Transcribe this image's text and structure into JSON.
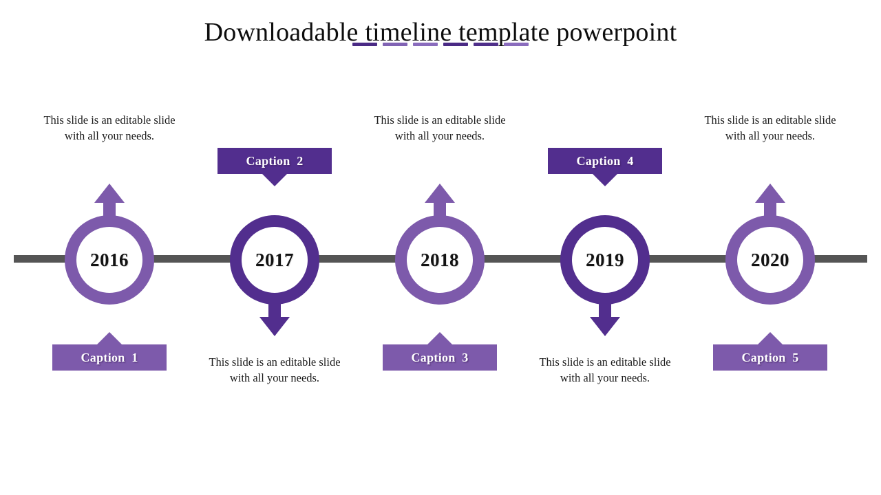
{
  "slide": {
    "title": "Downloadable timeline template powerpoint",
    "background_color": "#ffffff",
    "axis_color": "#555555"
  },
  "theme": {
    "purple_dark": "#522e8e",
    "purple_light": "#7d5aab",
    "text_color": "#1b1b1b",
    "caption_text_color": "#ffffff"
  },
  "title_dashes": [
    {
      "color": "#4a2a85"
    },
    {
      "color": "#8163b4"
    },
    {
      "color": "#8a6cbd"
    },
    {
      "color": "#4a2a85"
    },
    {
      "color": "#4f2f8a"
    },
    {
      "color": "#8a6cbd"
    }
  ],
  "body_text": "This slide is an editable slide with all your needs.",
  "nodes": [
    {
      "year": "2016",
      "caption": "Caption  1",
      "description": "This slide is an editable slide with all your needs.",
      "color": "#7d5aab",
      "arrow_direction": "up",
      "caption_position": "bottom",
      "description_position": "top"
    },
    {
      "year": "2017",
      "caption": "Caption  2",
      "description": "This slide is an editable slide with all your needs.",
      "color": "#522e8e",
      "arrow_direction": "down",
      "caption_position": "top",
      "description_position": "bottom"
    },
    {
      "year": "2018",
      "caption": "Caption  3",
      "description": "This slide is an editable slide with all your needs.",
      "color": "#7d5aab",
      "arrow_direction": "up",
      "caption_position": "bottom",
      "description_position": "top"
    },
    {
      "year": "2019",
      "caption": "Caption  4",
      "description": "This slide is an editable slide with all your needs.",
      "color": "#522e8e",
      "arrow_direction": "down",
      "caption_position": "top",
      "description_position": "bottom"
    },
    {
      "year": "2020",
      "caption": "Caption  5",
      "description": "This slide is an editable slide with all your needs.",
      "color": "#7d5aab",
      "arrow_direction": "up",
      "caption_position": "bottom",
      "description_position": "top"
    }
  ]
}
